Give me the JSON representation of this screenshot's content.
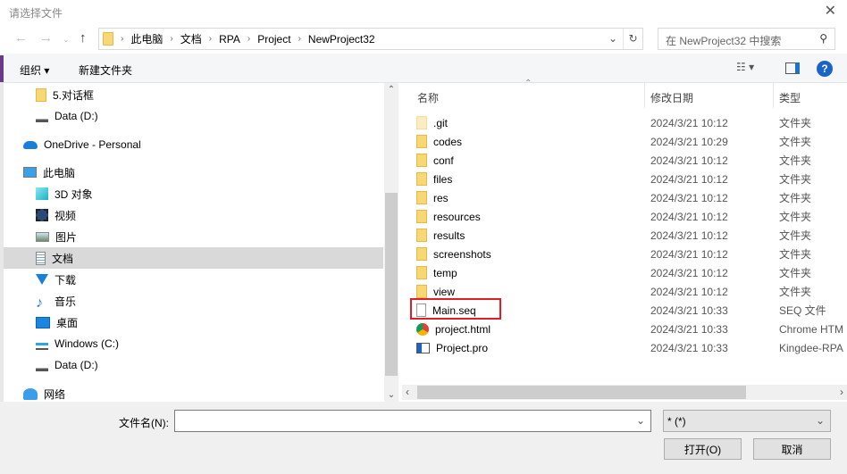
{
  "window": {
    "title": "请选择文件",
    "close_icon": "close-icon"
  },
  "address": {
    "segments": [
      "此电脑",
      "文档",
      "RPA",
      "Project",
      "NewProject32"
    ]
  },
  "search": {
    "placeholder": "在 NewProject32 中搜索"
  },
  "toolbar": {
    "organize": "组织 ▾",
    "new_folder": "新建文件夹"
  },
  "nav_pane": {
    "items": [
      {
        "label": "5.对话框",
        "icon": "folder-icon",
        "indent": 2
      },
      {
        "label": "Data (D:)",
        "icon": "drive-icon",
        "indent": 2
      },
      {
        "label": "OneDrive - Personal",
        "icon": "cloud-icon",
        "indent": 1
      },
      {
        "label": "此电脑",
        "icon": "computer-icon",
        "indent": 1
      },
      {
        "label": "3D 对象",
        "icon": "cube-icon",
        "indent": 2
      },
      {
        "label": "视频",
        "icon": "video-icon",
        "indent": 2
      },
      {
        "label": "图片",
        "icon": "picture-icon",
        "indent": 2
      },
      {
        "label": "文档",
        "icon": "document-icon",
        "indent": 2,
        "selected": true
      },
      {
        "label": "下载",
        "icon": "download-icon",
        "indent": 2
      },
      {
        "label": "音乐",
        "icon": "music-icon",
        "indent": 2
      },
      {
        "label": "桌面",
        "icon": "desktop-icon",
        "indent": 2
      },
      {
        "label": "Windows (C:)",
        "icon": "windows-drive-icon",
        "indent": 2
      },
      {
        "label": "Data (D:)",
        "icon": "drive-icon",
        "indent": 2
      },
      {
        "label": "网络",
        "icon": "network-icon",
        "indent": 1
      }
    ]
  },
  "file_list": {
    "columns": [
      "名称",
      "修改日期",
      "类型"
    ],
    "rows": [
      {
        "name": ".git",
        "date": "2024/3/21 10:12",
        "type": "文件夹",
        "icon": "folder-hidden-icon"
      },
      {
        "name": "codes",
        "date": "2024/3/21 10:29",
        "type": "文件夹",
        "icon": "folder-icon"
      },
      {
        "name": "conf",
        "date": "2024/3/21 10:12",
        "type": "文件夹",
        "icon": "folder-icon"
      },
      {
        "name": "files",
        "date": "2024/3/21 10:12",
        "type": "文件夹",
        "icon": "folder-icon"
      },
      {
        "name": "res",
        "date": "2024/3/21 10:12",
        "type": "文件夹",
        "icon": "folder-icon"
      },
      {
        "name": "resources",
        "date": "2024/3/21 10:12",
        "type": "文件夹",
        "icon": "folder-icon"
      },
      {
        "name": "results",
        "date": "2024/3/21 10:12",
        "type": "文件夹",
        "icon": "folder-icon"
      },
      {
        "name": "screenshots",
        "date": "2024/3/21 10:12",
        "type": "文件夹",
        "icon": "folder-icon"
      },
      {
        "name": "temp",
        "date": "2024/3/21 10:12",
        "type": "文件夹",
        "icon": "folder-icon"
      },
      {
        "name": "view",
        "date": "2024/3/21 10:12",
        "type": "文件夹",
        "icon": "folder-icon"
      },
      {
        "name": "Main.seq",
        "date": "2024/3/21 10:33",
        "type": "SEQ 文件",
        "icon": "file-icon",
        "highlighted": true
      },
      {
        "name": "project.html",
        "date": "2024/3/21 10:33",
        "type": "Chrome HTM",
        "icon": "chrome-icon"
      },
      {
        "name": "Project.pro",
        "date": "2024/3/21 10:33",
        "type": "Kingdee-RPA",
        "icon": "app-file-icon"
      }
    ]
  },
  "bottom": {
    "filename_label": "文件名(N):",
    "filename_value": "",
    "filter": "* (*)",
    "open": "打开(O)",
    "cancel": "取消"
  },
  "colors": {
    "highlight_border": "#e01e25",
    "selection": "#d9d9d9",
    "folder": "#f8d775"
  }
}
